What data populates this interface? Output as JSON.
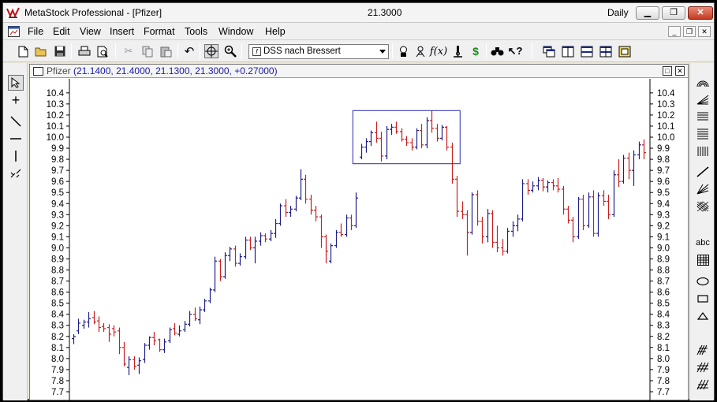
{
  "window": {
    "title": "MetaStock Professional - [Pfizer]",
    "price": "21.3000",
    "period": "Daily"
  },
  "menu": [
    "File",
    "Edit",
    "View",
    "Insert",
    "Format",
    "Tools",
    "Window",
    "Help"
  ],
  "toolbar": {
    "expert_select": "DSS nach Bressert"
  },
  "chart": {
    "security": "Pfizer",
    "ohlc_text": "(21.1400, 21.4000, 21.1300, 21.3000, +0.27000)"
  },
  "chart_data": {
    "type": "ohlc",
    "ylim": [
      7.65,
      10.47
    ],
    "y_ticks": [
      "10.4",
      "10.3",
      "10.2",
      "10.1",
      "10.0",
      "9.9",
      "9.8",
      "9.7",
      "9.6",
      "9.5",
      "9.4",
      "9.3",
      "9.2",
      "9.1",
      "9.0",
      "8.9",
      "8.8",
      "8.7",
      "8.6",
      "8.5",
      "8.4",
      "8.3",
      "8.2",
      "8.1",
      "8.0",
      "7.9",
      "7.8",
      "7.7"
    ],
    "colors": {
      "up": "#1f1f8a",
      "down": "#cc1f1f",
      "box": "#2a2ab0"
    },
    "bars": [
      {
        "o": 8.18,
        "h": 8.22,
        "l": 8.13,
        "c": 8.2
      },
      {
        "o": 8.25,
        "h": 8.36,
        "l": 8.22,
        "c": 8.32
      },
      {
        "o": 8.3,
        "h": 8.35,
        "l": 8.27,
        "c": 8.33
      },
      {
        "o": 8.33,
        "h": 8.42,
        "l": 8.28,
        "c": 8.36
      },
      {
        "o": 8.37,
        "h": 8.43,
        "l": 8.31,
        "c": 8.33
      },
      {
        "o": 8.34,
        "h": 8.38,
        "l": 8.24,
        "c": 8.28
      },
      {
        "o": 8.29,
        "h": 8.32,
        "l": 8.24,
        "c": 8.27
      },
      {
        "o": 8.28,
        "h": 8.31,
        "l": 8.15,
        "c": 8.22
      },
      {
        "o": 8.27,
        "h": 8.3,
        "l": 8.2,
        "c": 8.24
      },
      {
        "o": 8.25,
        "h": 8.28,
        "l": 8.04,
        "c": 8.1
      },
      {
        "o": 8.1,
        "h": 8.15,
        "l": 7.93,
        "c": 7.95
      },
      {
        "o": 7.92,
        "h": 8.02,
        "l": 7.85,
        "c": 7.99
      },
      {
        "o": 7.99,
        "h": 8.02,
        "l": 7.9,
        "c": 7.93
      },
      {
        "o": 7.94,
        "h": 8.01,
        "l": 7.86,
        "c": 7.98
      },
      {
        "o": 7.99,
        "h": 8.14,
        "l": 7.96,
        "c": 8.12
      },
      {
        "o": 8.12,
        "h": 8.2,
        "l": 8.08,
        "c": 8.19
      },
      {
        "o": 8.19,
        "h": 8.24,
        "l": 8.12,
        "c": 8.16
      },
      {
        "o": 8.17,
        "h": 8.18,
        "l": 8.06,
        "c": 8.08
      },
      {
        "o": 8.08,
        "h": 8.18,
        "l": 8.05,
        "c": 8.15
      },
      {
        "o": 8.16,
        "h": 8.28,
        "l": 8.14,
        "c": 8.26
      },
      {
        "o": 8.27,
        "h": 8.32,
        "l": 8.21,
        "c": 8.23
      },
      {
        "o": 8.22,
        "h": 8.3,
        "l": 8.2,
        "c": 8.25
      },
      {
        "o": 8.26,
        "h": 8.34,
        "l": 8.24,
        "c": 8.31
      },
      {
        "o": 8.31,
        "h": 8.43,
        "l": 8.29,
        "c": 8.4
      },
      {
        "o": 8.4,
        "h": 8.46,
        "l": 8.34,
        "c": 8.36
      },
      {
        "o": 8.35,
        "h": 8.47,
        "l": 8.31,
        "c": 8.44
      },
      {
        "o": 8.44,
        "h": 8.54,
        "l": 8.42,
        "c": 8.52
      },
      {
        "o": 8.52,
        "h": 8.64,
        "l": 8.5,
        "c": 8.62
      },
      {
        "o": 8.62,
        "h": 8.92,
        "l": 8.6,
        "c": 8.88
      },
      {
        "o": 8.88,
        "h": 8.9,
        "l": 8.7,
        "c": 8.74
      },
      {
        "o": 8.74,
        "h": 8.96,
        "l": 8.72,
        "c": 8.93
      },
      {
        "o": 8.93,
        "h": 9.01,
        "l": 8.88,
        "c": 8.99
      },
      {
        "o": 8.99,
        "h": 9.02,
        "l": 8.83,
        "c": 8.86
      },
      {
        "o": 8.86,
        "h": 8.95,
        "l": 8.84,
        "c": 8.92
      },
      {
        "o": 8.92,
        "h": 9.1,
        "l": 8.9,
        "c": 9.07
      },
      {
        "o": 9.07,
        "h": 9.1,
        "l": 8.98,
        "c": 9.0
      },
      {
        "o": 9.0,
        "h": 9.1,
        "l": 8.86,
        "c": 9.06
      },
      {
        "o": 9.06,
        "h": 9.14,
        "l": 9.02,
        "c": 9.11
      },
      {
        "o": 9.11,
        "h": 9.13,
        "l": 9.05,
        "c": 9.08
      },
      {
        "o": 9.08,
        "h": 9.16,
        "l": 9.06,
        "c": 9.13
      },
      {
        "o": 9.13,
        "h": 9.26,
        "l": 9.09,
        "c": 9.22
      },
      {
        "o": 9.22,
        "h": 9.4,
        "l": 9.2,
        "c": 9.38
      },
      {
        "o": 9.38,
        "h": 9.44,
        "l": 9.28,
        "c": 9.32
      },
      {
        "o": 9.32,
        "h": 9.38,
        "l": 9.28,
        "c": 9.35
      },
      {
        "o": 9.35,
        "h": 9.47,
        "l": 9.33,
        "c": 9.45
      },
      {
        "o": 9.45,
        "h": 9.71,
        "l": 9.43,
        "c": 9.62
      },
      {
        "o": 9.62,
        "h": 9.66,
        "l": 9.4,
        "c": 9.44
      },
      {
        "o": 9.44,
        "h": 9.48,
        "l": 9.3,
        "c": 9.34
      },
      {
        "o": 9.34,
        "h": 9.38,
        "l": 9.24,
        "c": 9.28
      },
      {
        "o": 9.28,
        "h": 9.3,
        "l": 9.0,
        "c": 9.1
      },
      {
        "o": 9.1,
        "h": 9.12,
        "l": 8.86,
        "c": 8.97
      },
      {
        "o": 8.88,
        "h": 9.04,
        "l": 8.86,
        "c": 9.02
      },
      {
        "o": 9.02,
        "h": 9.16,
        "l": 9.0,
        "c": 9.14
      },
      {
        "o": 9.14,
        "h": 9.22,
        "l": 9.1,
        "c": 9.12
      },
      {
        "o": 9.12,
        "h": 9.3,
        "l": 9.1,
        "c": 9.27
      },
      {
        "o": 9.27,
        "h": 9.3,
        "l": 9.16,
        "c": 9.2
      },
      {
        "o": 9.2,
        "h": 9.5,
        "l": 9.18,
        "c": 9.45
      },
      {
        "o": 9.82,
        "h": 9.94,
        "l": 9.8,
        "c": 9.91
      },
      {
        "o": 9.91,
        "h": 9.99,
        "l": 9.86,
        "c": 9.96
      },
      {
        "o": 9.96,
        "h": 10.06,
        "l": 9.92,
        "c": 10.04
      },
      {
        "o": 10.04,
        "h": 10.14,
        "l": 9.95,
        "c": 9.99
      },
      {
        "o": 9.99,
        "h": 10.05,
        "l": 9.78,
        "c": 9.83
      },
      {
        "o": 9.83,
        "h": 10.1,
        "l": 9.8,
        "c": 10.07
      },
      {
        "o": 10.07,
        "h": 10.12,
        "l": 10.02,
        "c": 10.09
      },
      {
        "o": 10.09,
        "h": 10.14,
        "l": 10.03,
        "c": 10.05
      },
      {
        "o": 10.05,
        "h": 10.08,
        "l": 9.96,
        "c": 9.98
      },
      {
        "o": 9.98,
        "h": 10.01,
        "l": 9.92,
        "c": 9.95
      },
      {
        "o": 9.95,
        "h": 9.99,
        "l": 9.88,
        "c": 9.91
      },
      {
        "o": 9.91,
        "h": 10.08,
        "l": 9.89,
        "c": 10.06
      },
      {
        "o": 10.06,
        "h": 10.12,
        "l": 9.9,
        "c": 9.93
      },
      {
        "o": 9.93,
        "h": 10.18,
        "l": 9.9,
        "c": 10.15
      },
      {
        "o": 10.15,
        "h": 10.24,
        "l": 10.04,
        "c": 10.08
      },
      {
        "o": 10.08,
        "h": 10.12,
        "l": 9.96,
        "c": 9.99
      },
      {
        "o": 9.99,
        "h": 10.11,
        "l": 9.97,
        "c": 10.09
      },
      {
        "o": 10.09,
        "h": 10.1,
        "l": 9.88,
        "c": 9.91
      },
      {
        "o": 9.91,
        "h": 9.95,
        "l": 9.58,
        "c": 9.62
      },
      {
        "o": 9.62,
        "h": 9.65,
        "l": 9.28,
        "c": 9.33
      },
      {
        "o": 9.33,
        "h": 9.42,
        "l": 9.26,
        "c": 9.3
      },
      {
        "o": 9.3,
        "h": 9.34,
        "l": 8.93,
        "c": 9.14
      },
      {
        "o": 9.14,
        "h": 9.5,
        "l": 9.12,
        "c": 9.48
      },
      {
        "o": 9.48,
        "h": 9.52,
        "l": 9.2,
        "c": 9.24
      },
      {
        "o": 9.24,
        "h": 9.28,
        "l": 9.04,
        "c": 9.1
      },
      {
        "o": 9.1,
        "h": 9.35,
        "l": 9.05,
        "c": 9.31
      },
      {
        "o": 9.31,
        "h": 9.34,
        "l": 9.0,
        "c": 9.05
      },
      {
        "o": 9.05,
        "h": 9.2,
        "l": 8.96,
        "c": 9.0
      },
      {
        "o": 9.0,
        "h": 9.08,
        "l": 8.93,
        "c": 8.97
      },
      {
        "o": 8.97,
        "h": 9.18,
        "l": 8.95,
        "c": 9.15
      },
      {
        "o": 9.15,
        "h": 9.24,
        "l": 9.1,
        "c": 9.2
      },
      {
        "o": 9.2,
        "h": 9.3,
        "l": 9.15,
        "c": 9.26
      },
      {
        "o": 9.26,
        "h": 9.62,
        "l": 9.24,
        "c": 9.58
      },
      {
        "o": 9.58,
        "h": 9.62,
        "l": 9.48,
        "c": 9.52
      },
      {
        "o": 9.52,
        "h": 9.6,
        "l": 9.5,
        "c": 9.56
      },
      {
        "o": 9.56,
        "h": 9.64,
        "l": 9.52,
        "c": 9.61
      },
      {
        "o": 9.61,
        "h": 9.63,
        "l": 9.51,
        "c": 9.55
      },
      {
        "o": 9.55,
        "h": 9.61,
        "l": 9.5,
        "c": 9.59
      },
      {
        "o": 9.59,
        "h": 9.62,
        "l": 9.52,
        "c": 9.56
      },
      {
        "o": 9.56,
        "h": 9.63,
        "l": 9.5,
        "c": 9.53
      },
      {
        "o": 9.53,
        "h": 9.56,
        "l": 9.3,
        "c": 9.35
      },
      {
        "o": 9.35,
        "h": 9.38,
        "l": 9.22,
        "c": 9.25
      },
      {
        "o": 9.25,
        "h": 9.28,
        "l": 9.05,
        "c": 9.1
      },
      {
        "o": 9.1,
        "h": 9.46,
        "l": 9.08,
        "c": 9.44
      },
      {
        "o": 9.44,
        "h": 9.48,
        "l": 9.16,
        "c": 9.2
      },
      {
        "o": 9.2,
        "h": 9.5,
        "l": 9.18,
        "c": 9.46
      },
      {
        "o": 9.46,
        "h": 9.52,
        "l": 9.1,
        "c": 9.13
      },
      {
        "o": 9.13,
        "h": 9.5,
        "l": 9.1,
        "c": 9.47
      },
      {
        "o": 9.47,
        "h": 9.52,
        "l": 9.38,
        "c": 9.42
      },
      {
        "o": 9.42,
        "h": 9.48,
        "l": 9.26,
        "c": 9.3
      },
      {
        "o": 9.3,
        "h": 9.7,
        "l": 9.28,
        "c": 9.66
      },
      {
        "o": 9.66,
        "h": 9.8,
        "l": 9.55,
        "c": 9.6
      },
      {
        "o": 9.6,
        "h": 9.84,
        "l": 9.58,
        "c": 9.81
      },
      {
        "o": 9.81,
        "h": 9.86,
        "l": 9.62,
        "c": 9.7
      },
      {
        "o": 9.7,
        "h": 9.88,
        "l": 9.56,
        "c": 9.84
      },
      {
        "o": 9.84,
        "h": 9.96,
        "l": 9.8,
        "c": 9.93
      },
      {
        "o": 9.93,
        "h": 9.98,
        "l": 9.8,
        "c": 9.86
      }
    ],
    "highlight": {
      "first_bar": 56,
      "last_bar": 76,
      "high": 10.24,
      "low": 9.76
    }
  }
}
